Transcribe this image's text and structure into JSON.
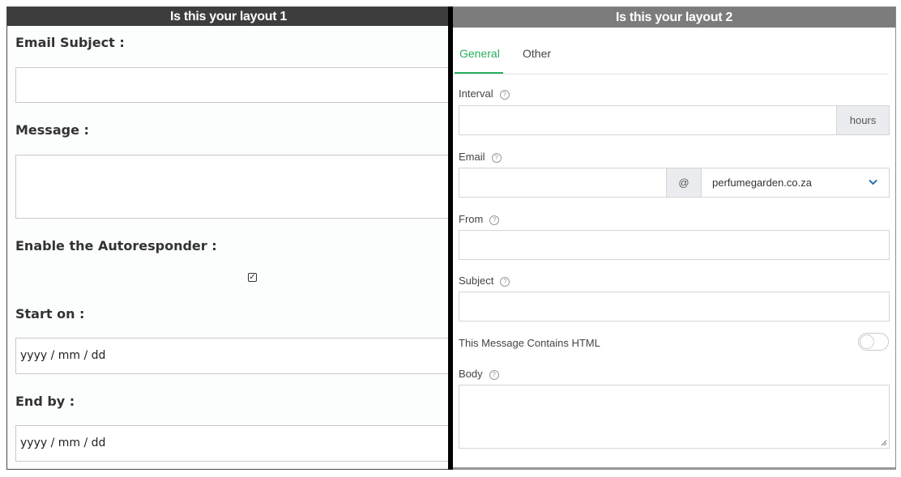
{
  "layout1": {
    "header": "Is this your layout 1",
    "email_subject_label": "Email Subject :",
    "message_label": "Message :",
    "enable_label": "Enable the Autoresponder :",
    "enable_checked": true,
    "start_label": "Start on :",
    "start_value": "yyyy / mm / dd",
    "end_label": "End by :",
    "end_value": "yyyy / mm / dd"
  },
  "layout2": {
    "header": "Is this your layout 2",
    "tabs": [
      {
        "label": "General",
        "active": true
      },
      {
        "label": "Other",
        "active": false
      }
    ],
    "interval_label": "Interval",
    "interval_addon": "hours",
    "email_label": "Email",
    "email_at": "@",
    "email_domain": "perfumegarden.co.za",
    "from_label": "From",
    "subject_label": "Subject",
    "html_toggle_label": "This Message Contains HTML",
    "html_toggle_on": false,
    "body_label": "Body",
    "help_glyph": "?"
  },
  "colors": {
    "accent_green": "#27ae60",
    "dropdown_blue": "#2d6db5",
    "header1_bg": "#3d3d3d",
    "header2_bg": "#7c7c7c"
  }
}
